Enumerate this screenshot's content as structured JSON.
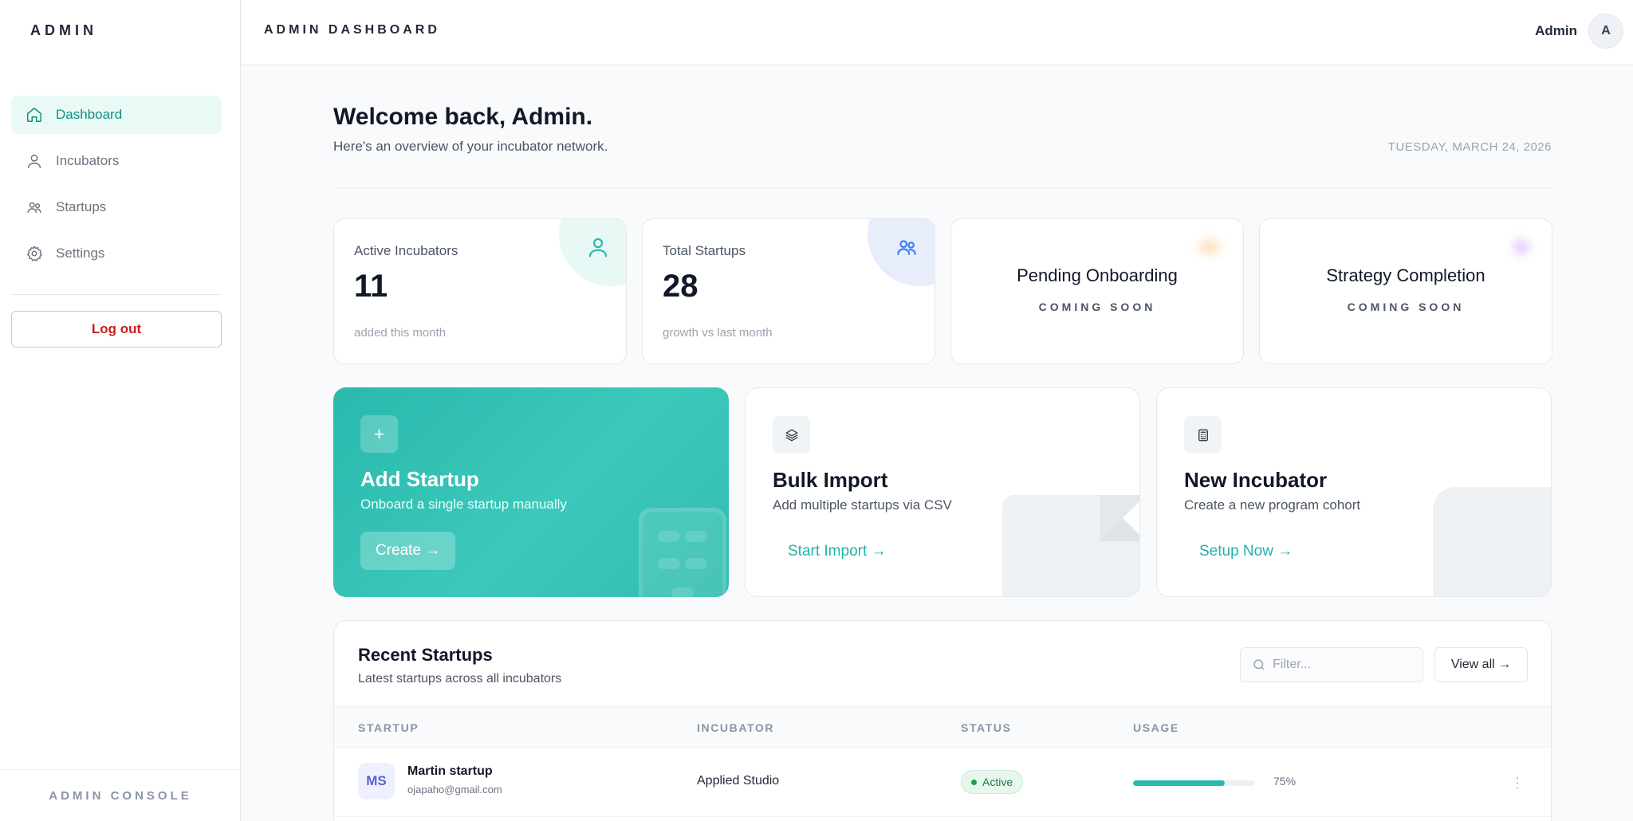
{
  "sidebar": {
    "brand": "ADMIN",
    "items": [
      {
        "label": "Dashboard",
        "icon": "home-icon",
        "active": true
      },
      {
        "label": "Incubators",
        "icon": "user-icon"
      },
      {
        "label": "Startups",
        "icon": "users-icon"
      },
      {
        "label": "Settings",
        "icon": "gear-icon"
      }
    ],
    "logout_label": "Log out",
    "footer": "ADMIN CONSOLE"
  },
  "header": {
    "title": "ADMIN DASHBOARD",
    "user_name": "Admin",
    "avatar_initial": "A"
  },
  "main": {
    "welcome": "Welcome back, Admin.",
    "subtitle": "Here's an overview of your incubator network.",
    "date": "TUESDAY, MARCH 24, 2026"
  },
  "stats": [
    {
      "label": "Active Incubators",
      "value": "11",
      "foot": "added this month",
      "accent": "#2bb9ad"
    },
    {
      "label": "Total Startups",
      "value": "28",
      "foot": "growth vs last month",
      "accent": "#3b82f6"
    },
    {
      "label": "Pending Onboarding",
      "badge": "COMING SOON",
      "accent": "#f97316"
    },
    {
      "label": "Strategy Completion",
      "badge": "COMING SOON",
      "accent": "#a855f7"
    }
  ],
  "actions": [
    {
      "icon": "+",
      "title": "Add Startup",
      "desc": "Onboard a single startup manually",
      "button": "Create →"
    },
    {
      "title": "Bulk Import",
      "desc": "Add multiple startups via CSV",
      "button": "Start Import →"
    },
    {
      "title": "New Incubator",
      "desc": "Create a new program cohort",
      "button": "Setup Now →"
    }
  ],
  "recent": {
    "title": "Recent Startups",
    "subtitle": "Latest startups across all incubators",
    "filter_placeholder": "Filter...",
    "view_all": "View all →",
    "columns": [
      "STARTUP",
      "INCUBATOR",
      "STATUS",
      "USAGE"
    ],
    "rows": [
      {
        "initials": "MS",
        "name": "Martin startup",
        "email": "ojapaho@gmail.com",
        "incubator": "Applied Studio",
        "status": "Active",
        "usage_pct": 75,
        "usage_label": "75%",
        "more": "⋮"
      }
    ]
  },
  "colors": {
    "accent": "#2bb9ad",
    "danger": "#c81e1e",
    "active_bg": "#e9faf6"
  }
}
